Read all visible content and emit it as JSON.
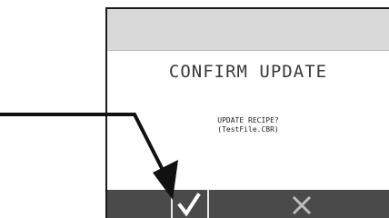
{
  "dialog": {
    "title": "CONFIRM UPDATE",
    "message_line1": "UPDATE RECIPE?",
    "message_line2": "(TestFile.CBR)"
  },
  "buttons": {
    "confirm_icon": "checkmark-icon",
    "cancel_icon": "close-icon"
  },
  "colors": {
    "header_bg": "#d9d9d9",
    "bar_bg": "#4a4a4a",
    "icon": "#ffffff",
    "cancel_icon": "#bdbdbd"
  }
}
